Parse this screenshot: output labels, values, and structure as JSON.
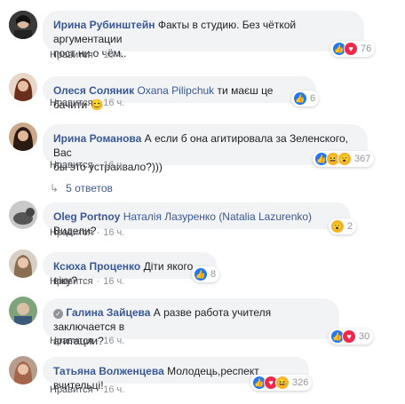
{
  "like_label": "Нравится",
  "comments": [
    {
      "author": "Ирина Рубинштейн",
      "tag": "",
      "text": "Факты в студию. Без чёткой аргументации",
      "text2": "пост ни о чём..",
      "time": "16 ч.",
      "reactions": [
        "like",
        "love"
      ],
      "count": "76"
    },
    {
      "author": "Олеся Соляник",
      "tag": "Oxana Pilipchuk",
      "text": "ти маєш це бачити",
      "text2": "",
      "time": "16 ч.",
      "reactions": [
        "like"
      ],
      "count": "6"
    },
    {
      "author": "Ирина Романова",
      "tag": "",
      "text": "А если б она агитировала за Зеленского, Вас",
      "text2": "бы это устраивало?)))",
      "time": "16 ч.",
      "reactions": [
        "like",
        "haha",
        "wow"
      ],
      "count": "367"
    },
    {
      "author": "Oleg Portnoy",
      "tag": "Наталія Лазуренко (Natalia Lazurenko)",
      "text": "Видели?",
      "text2": "",
      "time": "16 ч.",
      "reactions": [
        "wow"
      ],
      "count": "2"
    },
    {
      "author": "Ксюха Проценко",
      "tag": "",
      "text": "Діти якого віку?",
      "text2": "",
      "time": "16 ч.",
      "reactions": [
        "like"
      ],
      "count": "8"
    },
    {
      "author": "Галина Зайцева",
      "tag": "",
      "text": "А разве работа учителя заключается в",
      "text2": "агитации?",
      "time": "16 ч.",
      "reactions": [
        "like",
        "love"
      ],
      "count": "30"
    },
    {
      "author": "Татьяна Волженцева",
      "tag": "",
      "text": "Молодець,респект вчительці!",
      "text2": "",
      "time": "16 ч.",
      "reactions": [
        "like",
        "love",
        "haha"
      ],
      "count": "326"
    }
  ],
  "replies_label": "5 ответов",
  "emoji_smile": "😊",
  "colors": {
    "link": "#385898",
    "bubble": "#f2f3f5",
    "meta": "#90949c"
  }
}
